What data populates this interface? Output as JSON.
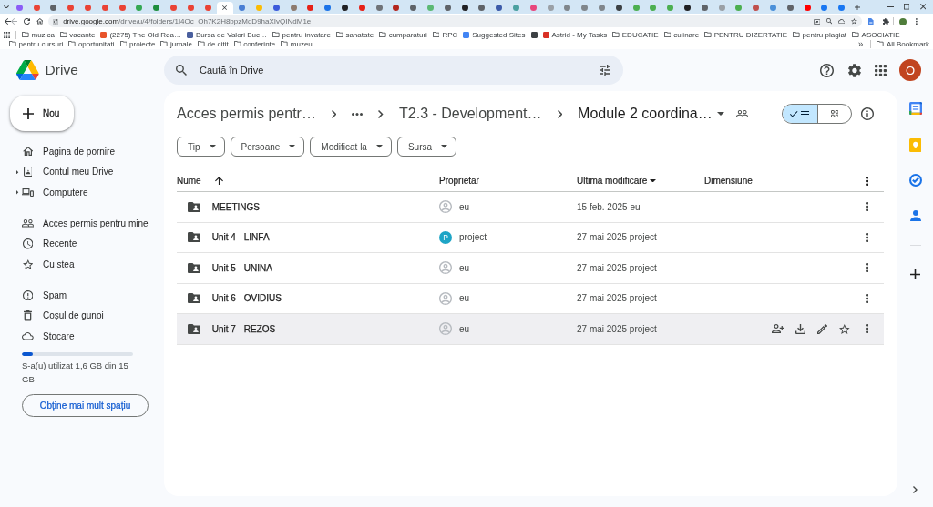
{
  "browser": {
    "tabs": [
      {
        "color": "#8b5cf6",
        "selected": false
      },
      {
        "color": "#ea4335",
        "selected": false
      },
      {
        "color": "#5f6368",
        "selected": false
      },
      {
        "color": "#ea4335",
        "selected": false
      },
      {
        "color": "#ea4335",
        "selected": false
      },
      {
        "color": "#ea4335",
        "selected": false
      },
      {
        "color": "#ea4335",
        "selected": false
      },
      {
        "color": "#34a853",
        "selected": false
      },
      {
        "color": "#1e8e3e",
        "selected": false
      },
      {
        "color": "#ea4335",
        "selected": false
      },
      {
        "color": "#ea4335",
        "selected": false
      },
      {
        "color": "#ea4335",
        "selected": false
      },
      {
        "selected": true
      },
      {
        "color": "#4a7fd4",
        "selected": false
      },
      {
        "color": "#fbbc04",
        "selected": false
      },
      {
        "color": "#3b5bdb",
        "selected": false
      },
      {
        "color": "#8d7b6e",
        "selected": false
      },
      {
        "color": "#e62117",
        "selected": false
      },
      {
        "color": "#1a73e8",
        "selected": false
      },
      {
        "color": "#202124",
        "selected": false
      },
      {
        "color": "#e62117",
        "selected": false
      },
      {
        "color": "#6f7378",
        "selected": false
      },
      {
        "color": "#b3261e",
        "selected": false
      },
      {
        "color": "#5f6368",
        "selected": false
      },
      {
        "color": "#5bb974",
        "selected": false
      },
      {
        "color": "#5f6368",
        "selected": false
      },
      {
        "color": "#202124",
        "selected": false
      },
      {
        "color": "#5f6368",
        "selected": false
      },
      {
        "color": "#3c5ba9",
        "selected": false
      },
      {
        "color": "#4aa0a0",
        "selected": false
      },
      {
        "color": "#e8467c",
        "selected": false
      },
      {
        "color": "#9aa0a6",
        "selected": false
      },
      {
        "color": "#80868b",
        "selected": false
      },
      {
        "color": "#80868b",
        "selected": false
      },
      {
        "color": "#80868b",
        "selected": false
      },
      {
        "color": "#3c4043",
        "selected": false
      },
      {
        "color": "#4caf50",
        "selected": false
      },
      {
        "color": "#4caf50",
        "selected": false
      },
      {
        "color": "#4caf50",
        "selected": false
      },
      {
        "color": "#202124",
        "selected": false
      },
      {
        "color": "#5f6368",
        "selected": false
      },
      {
        "color": "#9aa0a6",
        "selected": false
      },
      {
        "color": "#4caf50",
        "selected": false
      },
      {
        "color": "#c0504d",
        "selected": false
      },
      {
        "color": "#4a90d9",
        "selected": false
      },
      {
        "color": "#5f6368",
        "selected": false
      },
      {
        "color": "#ff0000",
        "selected": false
      },
      {
        "color": "#1877f2",
        "selected": false
      },
      {
        "color": "#1877f2",
        "selected": false
      }
    ],
    "url": {
      "host": "drive.google.com",
      "path": "/drive/u/4/folders/1I4Oc_Oh7K2H8bpzMqD9haXIvQINdM1e"
    },
    "bookmarks": [
      {
        "kind": "folder",
        "label": "muzica"
      },
      {
        "kind": "folder",
        "label": "vacante"
      },
      {
        "kind": "site",
        "label": "(2275) The Old Rea…",
        "color": "#e8542b"
      },
      {
        "kind": "site",
        "label": "Bursa de Valori Buc…",
        "color": "#4a5f9e"
      },
      {
        "kind": "folder",
        "label": "pentru invatare"
      },
      {
        "kind": "folder",
        "label": "sanatate"
      },
      {
        "kind": "folder",
        "label": "cumparaturi"
      },
      {
        "kind": "folder",
        "label": "RPC"
      },
      {
        "kind": "site",
        "label": "Suggested Sites",
        "color": "#4285f4"
      },
      {
        "kind": "site",
        "color": "#3c4043"
      },
      {
        "kind": "site",
        "label": "Astrid - My Tasks",
        "color": "#d93025"
      },
      {
        "kind": "folder",
        "label": "EDUCATIE"
      },
      {
        "kind": "folder",
        "label": "culinare"
      },
      {
        "kind": "folder",
        "label": "PENTRU DIZERTATIE"
      },
      {
        "kind": "folder",
        "label": "pentru plagiat"
      },
      {
        "kind": "folder",
        "label": "ASOCIATIE"
      },
      {
        "kind": "folder",
        "label": "pentru cursuri"
      },
      {
        "kind": "folder",
        "label": "oportunitati"
      },
      {
        "kind": "folder",
        "label": "proiecte"
      },
      {
        "kind": "folder",
        "label": "jurnale"
      },
      {
        "kind": "folder",
        "label": "de citit"
      },
      {
        "kind": "folder",
        "label": "conferinte"
      },
      {
        "kind": "folder",
        "label": "muzeu"
      }
    ],
    "overflow": "»",
    "all_bookmarks": "All Bookmark"
  },
  "header": {
    "app_name": "Drive",
    "search": {
      "placeholder": "Caută în Drive"
    },
    "account_initial": "O"
  },
  "sidebar": {
    "new_button": "Nou",
    "groups": [
      {
        "items": [
          {
            "kind": "home",
            "label": "Pagina de pornire",
            "expandable": false,
            "selected": false
          },
          {
            "kind": "my-drive",
            "label": "Contul meu Drive",
            "expandable": true,
            "selected": false
          },
          {
            "kind": "computers",
            "label": "Computere",
            "expandable": true,
            "selected": false
          }
        ]
      },
      {
        "items": [
          {
            "kind": "shared",
            "label": "Acces permis pentru mine",
            "expandable": false,
            "selected": false
          },
          {
            "kind": "recent",
            "label": "Recente",
            "expandable": false,
            "selected": false
          },
          {
            "kind": "starred",
            "label": "Cu stea",
            "expandable": false,
            "selected": false
          }
        ]
      },
      {
        "items": [
          {
            "kind": "spam",
            "label": "Spam",
            "expandable": false,
            "selected": false
          },
          {
            "kind": "trash",
            "label": "Coșul de gunoi",
            "expandable": false,
            "selected": false
          },
          {
            "kind": "storage",
            "label": "Stocare",
            "expandable": false,
            "selected": false
          }
        ]
      }
    ],
    "storage": {
      "level": 0.1,
      "text": "S-a(u) utilizat 1,6 GB din 15 GB",
      "button": "Obține mai mult spațiu"
    }
  },
  "breadcrumb": [
    {
      "kind": "folder",
      "label": "Acces permis pentr…"
    },
    {
      "kind": "overflow"
    },
    {
      "kind": "folder",
      "label": "T2.3 - Development…"
    },
    {
      "kind": "current",
      "label": "Module 2 coordina…"
    }
  ],
  "view_toggle": [
    {
      "kind": "list",
      "selected": true
    },
    {
      "kind": "grid",
      "selected": false
    }
  ],
  "filters": [
    "Tip",
    "Persoane",
    "Modificat la",
    "Sursa"
  ],
  "table": {
    "columns": [
      {
        "label": "Nume",
        "sorted": true,
        "menu": false
      },
      {
        "label": "Proprietar",
        "sorted": false,
        "menu": false
      },
      {
        "label": "Ultima modificare",
        "sorted": false,
        "menu": true
      },
      {
        "label": "Dimensiune",
        "sorted": false,
        "menu": false
      }
    ],
    "rows": [
      {
        "name": "MEETINGS",
        "owner": {
          "kind": "generic",
          "name": "eu"
        },
        "modified": "15 feb. 2025 eu",
        "size": "—",
        "hovered": false
      },
      {
        "name": "Unit 4 - LINFA",
        "owner": {
          "kind": "initial",
          "initial": "P",
          "color": "#1ea5c6",
          "name": "project"
        },
        "modified": "27 mai 2025 project",
        "size": "—",
        "hovered": false
      },
      {
        "name": "Unit 5 - UNINA",
        "owner": {
          "kind": "generic",
          "name": "eu"
        },
        "modified": "27 mai 2025 project",
        "size": "—",
        "hovered": false
      },
      {
        "name": "Unit 6 - OVIDIUS",
        "owner": {
          "kind": "generic",
          "name": "eu"
        },
        "modified": "27 mai 2025 project",
        "size": "—",
        "hovered": false
      },
      {
        "name": "Unit 7 - REZOS",
        "owner": {
          "kind": "generic",
          "name": "eu"
        },
        "modified": "27 mai 2025 project",
        "size": "—",
        "hovered": true
      }
    ]
  }
}
